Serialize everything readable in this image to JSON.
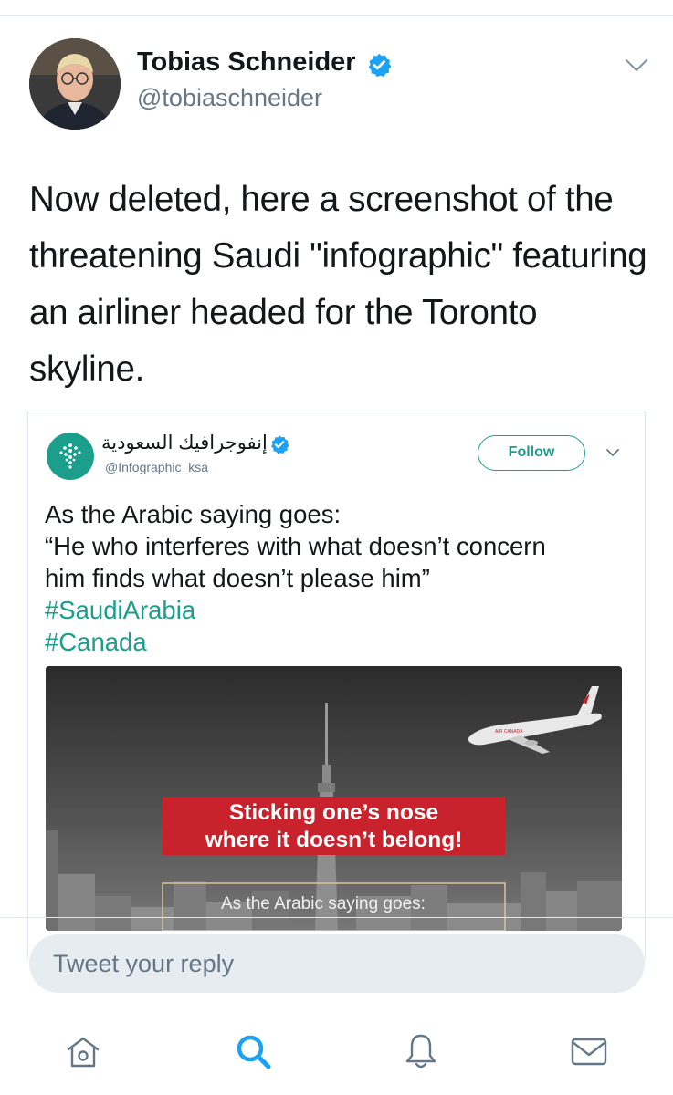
{
  "tweet": {
    "author_name": "Tobias Schneider",
    "author_handle": "@tobiaschneider",
    "verified": true,
    "text": "Now deleted, here a screenshot of the threatening Saudi \"infographic\" featuring an airliner headed for the Toronto skyline."
  },
  "quoted_tweet": {
    "author_name": "إنفوجرافيك السعودية",
    "author_handle": "@Infographic_ksa",
    "verified": true,
    "follow_label": "Follow",
    "text_lines": [
      "As the Arabic saying goes:",
      "“He who interferes with what doesn’t concern",
      "him finds what doesn’t please him”"
    ],
    "hashtags": [
      "#SaudiArabia",
      "#Canada"
    ],
    "image": {
      "banner_line1": "Sticking one’s nose",
      "banner_line2": "where it doesn’t belong!",
      "caption": "As the Arabic saying goes:",
      "plane_livery": "AIR CANADA"
    }
  },
  "reply": {
    "placeholder": "Tweet your reply"
  },
  "tab_bar": {
    "icons": [
      "home-icon",
      "search-icon",
      "notifications-icon",
      "messages-icon"
    ]
  },
  "colors": {
    "accent_twitter": "#1da1f2",
    "accent_quote": "#1b9e8c",
    "banner_red": "#c8232c",
    "muted_text": "#657786"
  }
}
